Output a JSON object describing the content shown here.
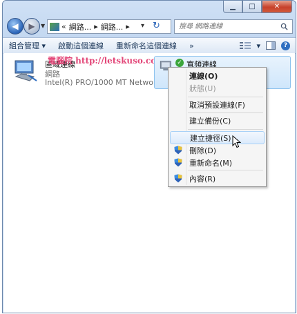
{
  "address": {
    "crumbs": [
      "«",
      "網路...",
      "▸",
      "網路...",
      "▸"
    ],
    "dropdown": "▾",
    "refresh": "↻"
  },
  "search": {
    "placeholder": "搜尋 網路連線"
  },
  "command_bar": {
    "items": [
      "組合管理 ▾",
      "啟動這個連線",
      "重新命名這個連線",
      "»"
    ],
    "view": "▾"
  },
  "connections": [
    {
      "name": "區域連線",
      "status": "網路",
      "device": "Intel(R) PRO/1000 MT Network ..."
    },
    {
      "name": "寬頻連線"
    }
  ],
  "watermark": "電腦院 http://letskuso.com",
  "context_menu": {
    "items": [
      {
        "label": "連線(O)",
        "style": "bold"
      },
      {
        "label": "狀態(U)",
        "style": "disabled"
      },
      {
        "label": "取消預設連線(F)"
      },
      {
        "label": "建立備份(C)"
      },
      {
        "label": "建立捷徑(S)",
        "style": "hover"
      },
      {
        "label": "刪除(D)",
        "icon": "shield-icon"
      },
      {
        "label": "重新命名(M)",
        "icon": "shield-icon"
      },
      {
        "label": "內容(R)",
        "icon": "shield-icon"
      }
    ]
  },
  "help": "?"
}
